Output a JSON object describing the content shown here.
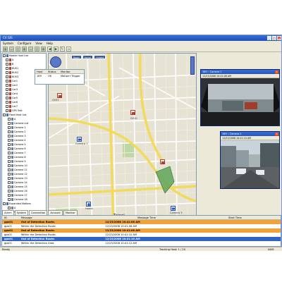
{
  "window": {
    "title": "CV GIS",
    "controls": [
      "_",
      "□",
      "×"
    ]
  },
  "menu": [
    "System",
    "Configure",
    "View",
    "Help"
  ],
  "toolbar": {
    "icons": [
      "layout-icon",
      "layout-icon",
      "layout-icon",
      "layout-icon",
      "layout-icon",
      "layout-icon",
      "layout-icon",
      "back-icon",
      "forward-icon",
      "refresh-icon",
      "home-icon"
    ]
  },
  "tree": {
    "header": "Mobile Host List",
    "items": [
      {
        "label": "Mobile Host List",
        "type": "grp"
      },
      {
        "label": "A",
        "type": "car"
      },
      {
        "label": "B",
        "type": "car"
      },
      {
        "label": "BUS1",
        "type": "car"
      },
      {
        "label": "BUS2",
        "type": "car"
      },
      {
        "label": "BUS3",
        "type": "car"
      },
      {
        "label": "Car1",
        "type": "car"
      },
      {
        "label": "Car2",
        "type": "car"
      },
      {
        "label": "Car3",
        "type": "car"
      },
      {
        "label": "Car4",
        "type": "car"
      },
      {
        "label": "Car5",
        "type": "car"
      },
      {
        "label": "Car6",
        "type": "car"
      },
      {
        "label": "Car7",
        "type": "car"
      },
      {
        "label": "GPS Test",
        "type": "car"
      },
      {
        "label": "Fixed Host List",
        "type": "grp"
      },
      {
        "label": "A",
        "type": "cam"
      },
      {
        "label": "Camera List",
        "type": "cam"
      },
      {
        "label": "Camera 1",
        "type": "cam"
      },
      {
        "label": "Camera 2",
        "type": "cam"
      },
      {
        "label": "Camera 3",
        "type": "cam"
      },
      {
        "label": "Camera 4",
        "type": "cam"
      },
      {
        "label": "Camera 5",
        "type": "cam"
      },
      {
        "label": "Camera 6",
        "type": "cam"
      },
      {
        "label": "Camera 7",
        "type": "cam"
      },
      {
        "label": "Camera 8",
        "type": "cam"
      },
      {
        "label": "Camera 9",
        "type": "cam"
      },
      {
        "label": "Camera 10",
        "type": "cam"
      },
      {
        "label": "Camera 11",
        "type": "cam"
      },
      {
        "label": "Camera 12",
        "type": "cam"
      },
      {
        "label": "Camera 13",
        "type": "cam"
      },
      {
        "label": "Camera 14",
        "type": "cam"
      },
      {
        "label": "Camera 15",
        "type": "cam"
      },
      {
        "label": "Camera 16",
        "type": "cam"
      },
      {
        "label": "Camera 17",
        "type": "cam"
      },
      {
        "label": "Camera 18",
        "type": "cam"
      },
      {
        "label": "Expanded Matters",
        "type": "grp"
      },
      {
        "label": "A",
        "type": "cam"
      },
      {
        "label": "Police",
        "type": "cam"
      },
      {
        "label": "B",
        "type": "cam"
      },
      {
        "label": "Home",
        "type": "cam"
      }
    ]
  },
  "map": {
    "mode_buttons": [
      "Road",
      "Aerial",
      "Hybrid"
    ],
    "labels": {
      "g031": "G031",
      "g010": "G010",
      "camera1": "Camera 1",
      "camera2": "Camera 2",
      "camera3": "Camera 3",
      "home": "Home",
      "city": "Taipei",
      "provider": "Virtual Earth"
    }
  },
  "status_grid": {
    "headers": [
      "Host",
      "Status",
      "Monitor"
    ],
    "row": [
      "169",
      "OK",
      "Motion+Trigger"
    ]
  },
  "camera_windows": [
    {
      "title": "169 :: Camera 1",
      "info": "12/23/2008 10:41:08 AM"
    },
    {
      "title": "169 :: Camera 2",
      "info": "12/23/2008 10:41:10 AM"
    }
  ],
  "tabs": [
    "Alarm",
    "System",
    "Connection",
    "Account",
    "Monitor"
  ],
  "alarm_list": {
    "headers": [
      "ID",
      "Message",
      "Message Time",
      "Start Time"
    ],
    "rows": [
      {
        "id": "gps01",
        "message": "Out of Detection Route.",
        "time": "12/23/2008 10:41:08 AM",
        "start": "",
        "style": "alt"
      },
      {
        "id": "gps01",
        "message": "Within the Detection Route.",
        "time": "12/23/2008 10:41:08 AM",
        "start": "",
        "style": "plain"
      },
      {
        "id": "gps01",
        "message": "Out of Detection Route.",
        "time": "12/23/2008 10:41:08 AM",
        "start": "",
        "style": "alt"
      },
      {
        "id": "gps01",
        "message": "Within the Detection Route.",
        "time": "12/23/2008 10:41:10 AM",
        "start": "",
        "style": "plain"
      },
      {
        "id": "gps01",
        "message": "Out of Detection Route.",
        "time": "12/23/2008 10:41:10 AM",
        "start": "",
        "style": "sel"
      },
      {
        "id": "gps01",
        "message": "Within the Detection Area.",
        "time": "12/23/2008 10:41:12 AM",
        "start": "",
        "style": "plain"
      }
    ]
  },
  "statusbar": {
    "left": "Ready",
    "middle": "Tracking Host: 1 / 20",
    "right": "NUM"
  },
  "colors": {
    "title_bar": "#2356c0",
    "alarm_orange": "#f0a33a",
    "selection_blue": "#3163c5",
    "map_background": "#e6e2d4",
    "major_road": "#f2da5c",
    "route_polygon": "#5fa55a"
  }
}
